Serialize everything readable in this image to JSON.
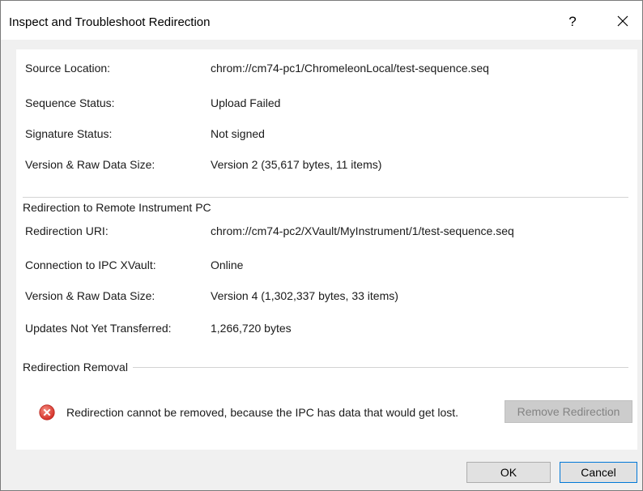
{
  "window": {
    "title": "Inspect and Troubleshoot Redirection",
    "help_label": "?"
  },
  "source": {
    "location_label": "Source Location:",
    "location_value": "chrom://cm74-pc1/ChromeleonLocal/test-sequence.seq",
    "sequence_status_label": "Sequence Status:",
    "sequence_status_value": "Upload Failed",
    "signature_status_label": "Signature Status:",
    "signature_status_value": "Not signed",
    "version_label": "Version & Raw Data Size:",
    "version_value": "Version 2 (35,617 bytes, 11 items)"
  },
  "redirection": {
    "group_title": "Redirection to Remote Instrument PC",
    "uri_label": "Redirection URI:",
    "uri_value": "chrom://cm74-pc2/XVault/MyInstrument/1/test-sequence.seq",
    "connection_label": "Connection to IPC XVault:",
    "connection_value": "Online",
    "version_label": "Version & Raw Data Size:",
    "version_value": "Version 4 (1,302,337 bytes, 33 items)",
    "updates_label": "Updates Not Yet Transferred:",
    "updates_value": "1,266,720 bytes"
  },
  "removal": {
    "group_title": "Redirection Removal",
    "error_icon": "error-circle-icon",
    "message": "Redirection cannot be removed, because the IPC has data that would get lost.",
    "remove_button_label": "Remove Redirection"
  },
  "footer": {
    "ok_label": "OK",
    "cancel_label": "Cancel"
  },
  "colors": {
    "error_red": "#d9403a",
    "default_button_border": "#0078d7"
  }
}
